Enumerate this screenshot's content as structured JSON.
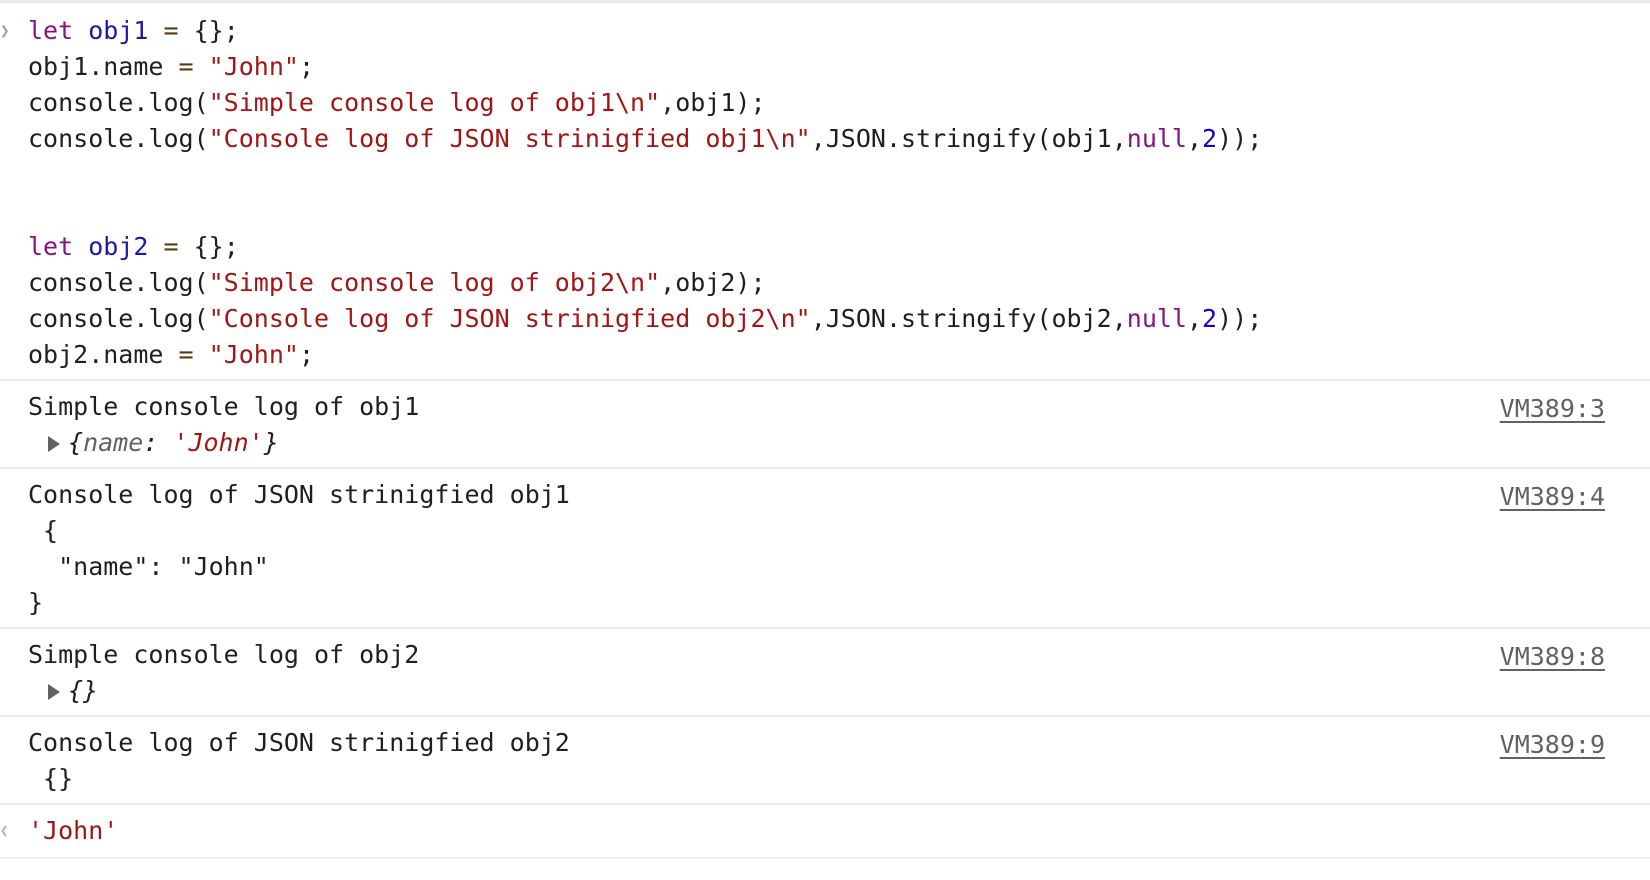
{
  "input": {
    "lines": [
      [
        {
          "t": "let ",
          "c": "kw"
        },
        {
          "t": "obj1",
          "c": "var"
        },
        {
          "t": " = ",
          "c": "op"
        },
        {
          "t": "{};",
          "c": ""
        }
      ],
      [
        {
          "t": "obj1.name ",
          "c": ""
        },
        {
          "t": "=",
          "c": "op"
        },
        {
          "t": " ",
          "c": ""
        },
        {
          "t": "\"John\"",
          "c": "str"
        },
        {
          "t": ";",
          "c": ""
        }
      ],
      [
        {
          "t": "console.log(",
          "c": ""
        },
        {
          "t": "\"Simple console log of obj1\\n\"",
          "c": "str"
        },
        {
          "t": ",obj1);",
          "c": ""
        }
      ],
      [
        {
          "t": "console.log(",
          "c": ""
        },
        {
          "t": "\"Console log of JSON strinigfied obj1\\n\"",
          "c": "str"
        },
        {
          "t": ",JSON.stringify(obj1,",
          "c": ""
        },
        {
          "t": "null",
          "c": "nul"
        },
        {
          "t": ",",
          "c": ""
        },
        {
          "t": "2",
          "c": "num"
        },
        {
          "t": "));",
          "c": ""
        }
      ],
      [],
      [],
      [
        {
          "t": "let ",
          "c": "kw"
        },
        {
          "t": "obj2",
          "c": "var"
        },
        {
          "t": " = ",
          "c": "op"
        },
        {
          "t": "{};",
          "c": ""
        }
      ],
      [
        {
          "t": "console.log(",
          "c": ""
        },
        {
          "t": "\"Simple console log of obj2\\n\"",
          "c": "str"
        },
        {
          "t": ",obj2);",
          "c": ""
        }
      ],
      [
        {
          "t": "console.log(",
          "c": ""
        },
        {
          "t": "\"Console log of JSON strinigfied obj2\\n\"",
          "c": "str"
        },
        {
          "t": ",JSON.stringify(obj2,",
          "c": ""
        },
        {
          "t": "null",
          "c": "nul"
        },
        {
          "t": ",",
          "c": ""
        },
        {
          "t": "2",
          "c": "num"
        },
        {
          "t": "));",
          "c": ""
        }
      ],
      [
        {
          "t": "obj2.name ",
          "c": ""
        },
        {
          "t": "=",
          "c": "op"
        },
        {
          "t": " ",
          "c": ""
        },
        {
          "t": "\"John\"",
          "c": "str"
        },
        {
          "t": ";",
          "c": ""
        }
      ]
    ]
  },
  "messages": [
    {
      "text": "Simple console log of obj1",
      "source": "VM389:3",
      "object": {
        "open": "{",
        "key": "name",
        "sep": ": ",
        "value": "'John'",
        "close": "}"
      }
    },
    {
      "text": "Console log of JSON strinigfied obj1",
      "source": "VM389:4",
      "lines": [
        " {",
        "  \"name\": \"John\"",
        "}"
      ]
    },
    {
      "text": "Simple console log of obj2",
      "source": "VM389:8",
      "object_empty": "{}"
    },
    {
      "text": "Console log of JSON strinigfied obj2",
      "source": "VM389:9",
      "lines": [
        " {}"
      ]
    }
  ],
  "result": {
    "value": "'John'"
  }
}
